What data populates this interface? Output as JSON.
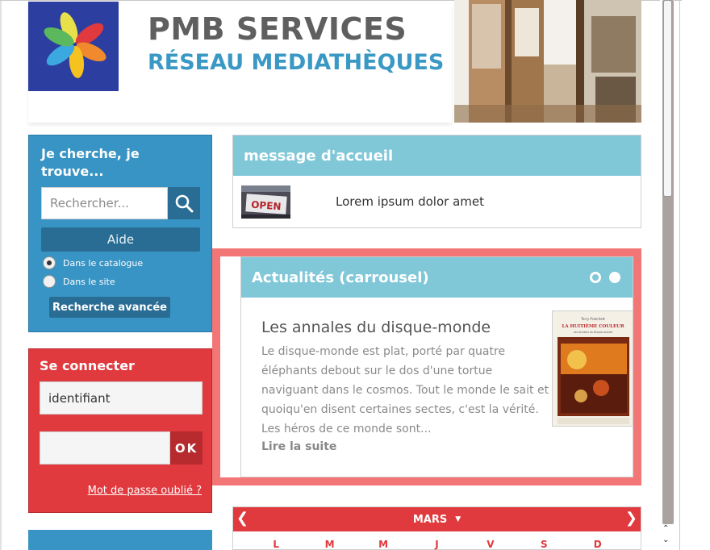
{
  "header": {
    "title": "PMB SERVICES",
    "subtitle": "RÉSEAU MEDIATHÈQUES",
    "logo_icon": "flower-logo-icon"
  },
  "search": {
    "title": "Je cherche, je trouve...",
    "placeholder": "Rechercher...",
    "help_label": "Aide",
    "option_catalog": "Dans le catalogue",
    "option_site": "Dans le site",
    "selected_option": "Dans le catalogue",
    "advanced_label": "Recherche avancée"
  },
  "login": {
    "title": "Se connecter",
    "id_value": "identifiant",
    "ok_label": "OK",
    "forgot_label": "Mot de passe oublié ?"
  },
  "welcome": {
    "title": "message d'accueil",
    "text": "Lorem ipsum dolor amet",
    "thumb_sign": "OPEN"
  },
  "carousel": {
    "title": "Actualités (carrousel)",
    "article_title": "Les annales du disque-monde",
    "article_body": "Le disque-monde est plat, porté par quatre éléphants debout sur le dos d'une tortue naviguant dans le cosmos. Tout le monde le sait et quoiqu'en disent certaines sectes, c'est la vérité. Les héros de ce monde sont...",
    "read_more": "Lire la suite",
    "book_author": "Terry Pratchett",
    "book_title": "LA HUITIÈME COULEUR",
    "book_series": "Les Annales du Disque-monde"
  },
  "calendar": {
    "month": "MARS",
    "days": [
      "L",
      "M",
      "M",
      "J",
      "V",
      "S",
      "D"
    ]
  },
  "colors": {
    "blue": "#3894c4",
    "red": "#e0393e",
    "teal_header": "#80c7d8",
    "carousel_border": "#f37677"
  }
}
